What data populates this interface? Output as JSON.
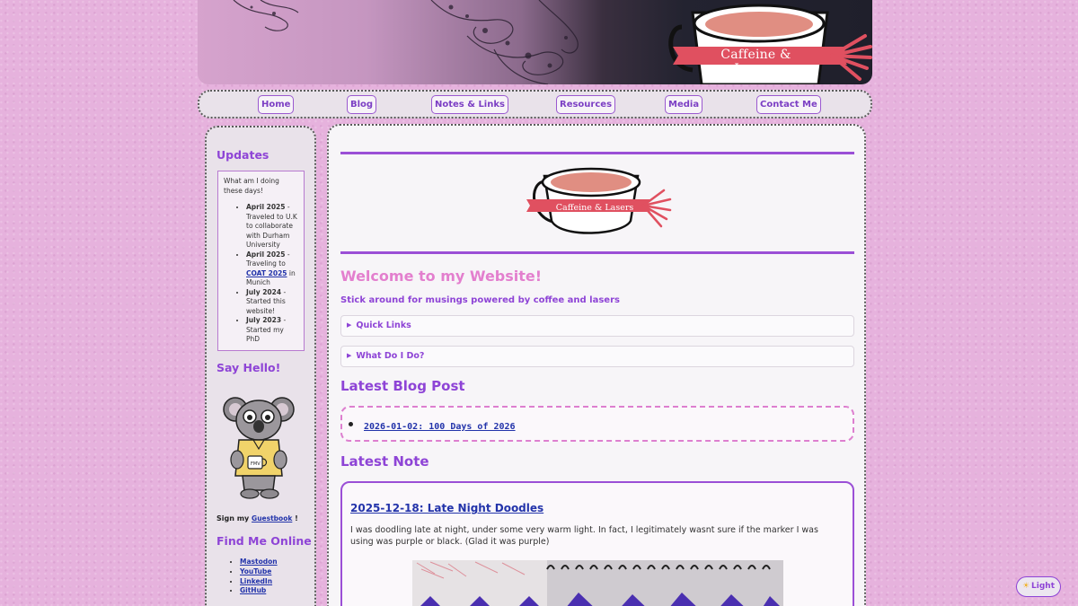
{
  "banner": {
    "site_title": "Caffeine & Lasers"
  },
  "nav": {
    "items": [
      {
        "label": "Home"
      },
      {
        "label": "Blog"
      },
      {
        "label": "Notes & Links"
      },
      {
        "label": "Resources"
      },
      {
        "label": "Media"
      },
      {
        "label": "Contact Me"
      }
    ]
  },
  "sidebar": {
    "updates_heading": "Updates",
    "updates_intro": "What am I doing these days!",
    "updates": [
      {
        "date": "April 2025",
        "text": " - Traveled to U.K to collaborate with Durham University"
      },
      {
        "date": "April 2025",
        "text_before": " - Traveling to ",
        "link": "COAT 2025",
        "text_after": " in Munich"
      },
      {
        "date": "July 2024",
        "text": " - Started this website!"
      },
      {
        "date": "July 2023",
        "text": " - Started my PhD"
      }
    ],
    "say_hello_heading": "Say Hello!",
    "koala_badge": "FMV",
    "guestbook_prefix": "Sign my ",
    "guestbook_link": "Guestbook",
    "guestbook_suffix": " !",
    "find_me_heading": "Find Me Online",
    "social_links": [
      "Mastodon",
      "YouTube",
      "LinkedIn",
      "GitHub"
    ]
  },
  "main": {
    "logo_title": "Caffeine & Lasers",
    "welcome_title": "Welcome to my Website!",
    "tagline": "Stick around for musings powered by coffee and lasers",
    "details": [
      {
        "label": "Quick Links"
      },
      {
        "label": "What Do I Do?"
      }
    ],
    "latest_blog_heading": "Latest Blog Post",
    "latest_blog_link": "2026-01-02: 100 Days of 2026",
    "latest_note_heading": "Latest Note",
    "note_title": "2025-12-18: Late Night Doodles",
    "note_body": "I was doodling late at night, under some very warm light. In fact, I legitimately wasnt sure if the marker I was using was purple or black. (Glad it was purple)"
  },
  "theme_toggle": {
    "label": "Light",
    "icon": "sun-icon"
  },
  "colors": {
    "accent_purple": "#8e44d6",
    "accent_pink": "#e37fce",
    "link_blue": "#2233aa",
    "page_background": "#e6b2dd",
    "ribbon_red": "#e05060"
  }
}
